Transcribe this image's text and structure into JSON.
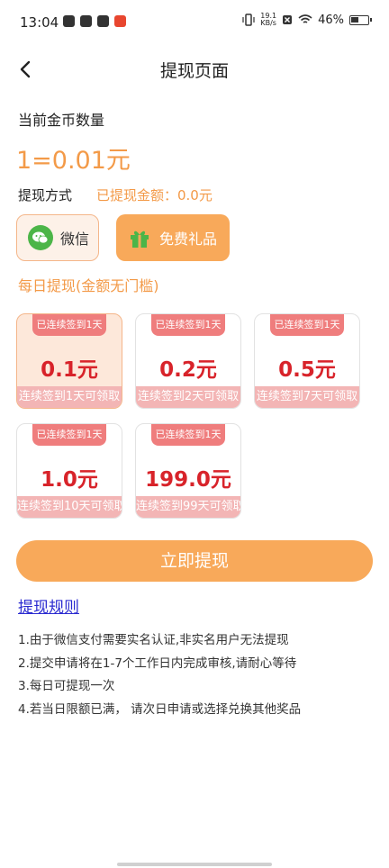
{
  "status_bar": {
    "time": "13:04",
    "speed_value": "19.1",
    "speed_unit": "KB/s",
    "battery": "46%"
  },
  "nav": {
    "title": "提现页面"
  },
  "coins": {
    "label": "当前金币数量",
    "rate": "1=0.01元"
  },
  "method": {
    "label": "提现方式",
    "withdrawn": "已提现金额：0.0元",
    "options": [
      {
        "label": "微信",
        "icon": "wechat-icon"
      },
      {
        "label": "免费礼品",
        "icon": "gift-icon"
      }
    ]
  },
  "daily": {
    "label": "每日提现(金额无门槛)",
    "cards": [
      {
        "badge": "已连续签到1天",
        "amount": "0.1元",
        "footer": "连续签到1天可领取"
      },
      {
        "badge": "已连续签到1天",
        "amount": "0.2元",
        "footer": "连续签到2天可领取"
      },
      {
        "badge": "已连续签到1天",
        "amount": "0.5元",
        "footer": "连续签到7天可领取"
      },
      {
        "badge": "已连续签到1天",
        "amount": "1.0元",
        "footer": "连续签到10天可领取"
      },
      {
        "badge": "已连续签到1天",
        "amount": "199.0元",
        "footer": "连续签到99天可领取"
      }
    ]
  },
  "withdraw_button": "立即提现",
  "rules": {
    "title": "提现规则",
    "items": [
      "1.由于微信支付需要实名认证,非实名用户无法提现",
      "2.提交申请将在1-7个工作日内完成审核,请耐心等待",
      "3.每日可提现一次",
      "4.若当日限额已满， 请次日申请或选择兑换其他奖品"
    ]
  },
  "colors": {
    "accent_orange": "#f8a95a",
    "text_orange": "#f39a48",
    "amount_red": "#d8232a",
    "badge_red": "#ef7d7d",
    "link_blue": "#2a2ad0"
  }
}
